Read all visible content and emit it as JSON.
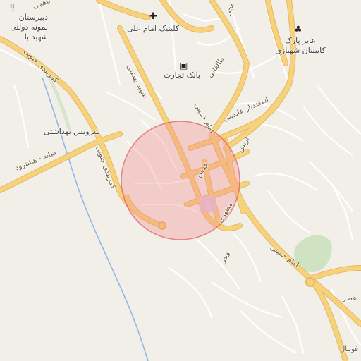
{
  "map": {
    "colors": {
      "background": "#f2efe9",
      "major_road": "#f7d27c",
      "major_road_casing": "#e6b85c",
      "minor_road": "#ffffff",
      "minor_road_casing": "#d7d2c8",
      "water": "#8db8e8",
      "park": "#cfe3c2",
      "highlight_fill": "#f28b8b",
      "highlight_stroke": "#e05a5a"
    },
    "labels": {
      "poi_school": "دبیرستان نمونه دولتی شهید با",
      "poi_clinic": "کلینیک امام علی",
      "poi_park": "عابر پارک کابینتان شهبازی",
      "poi_bank": "بانک تجارت",
      "poi_health": "سرویس بهداشتی",
      "street_kamarbandi_1": "کمربندی جنوبی",
      "street_kamarbandi_2": "کمربندی جنوبی",
      "street_shahid_beheshti": "شهید بهشتی",
      "street_taleghani": "طالقانی",
      "street_imam_khomeini_1": "امام خمینی",
      "street_imam_khomeini_2": "امام خمینی",
      "street_esfandiar": "اسفندیار عابدینی",
      "street_artesh": "ارتش",
      "street_ghods": "قدس",
      "street_motahari": "مطهری",
      "street_fajr": "فجر",
      "street_mianeh": "میانه - هشترود",
      "street_corner_top": "ناهجی",
      "street_corner_right": "مجی",
      "street_asr": "عصر",
      "street_football": "فوتبال"
    },
    "icons": {
      "clinic": "cross-icon",
      "bank": "bank-icon",
      "park": "tree-icon",
      "school": "school-icon"
    }
  }
}
